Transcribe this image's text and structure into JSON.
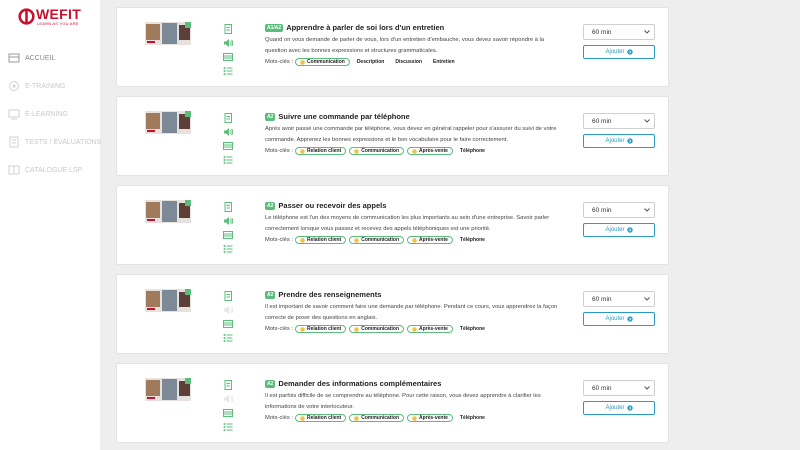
{
  "brand": {
    "name": "WEFIT",
    "tagline": "LEARN AS YOU ARE",
    "color": "#c8102e"
  },
  "sidebar": {
    "items": [
      {
        "label": "ACCUEIL",
        "icon": "home-icon",
        "active": true
      },
      {
        "label": "E-TRAINING",
        "icon": "training-icon",
        "active": false
      },
      {
        "label": "E-LEARNING",
        "icon": "elearning-icon",
        "active": false
      },
      {
        "label": "TESTS / ÉVALUATIONS",
        "icon": "tests-icon",
        "active": false
      },
      {
        "label": "CATALOGUE LSP",
        "icon": "catalogue-icon",
        "active": false
      }
    ]
  },
  "keywords_label": "Mots-clés :",
  "add_label": "Ajouter",
  "accent_color": "#5bbd7b",
  "button_color": "#2a9bc4",
  "courses": [
    {
      "level": "A1/A2",
      "title": "Apprendre à parler de soi lors d'un entretien",
      "description": "Quand on vous demande de parler de vous, lors d'un entretien d'embauche, vous devez savoir répondre à la question avec les bonnes expressions et structures grammaticales.",
      "duration": "60 min",
      "tags": [
        {
          "label": "Communication",
          "highlight": true
        },
        {
          "label": "Description",
          "highlight": false
        },
        {
          "label": "Discussion",
          "highlight": false
        },
        {
          "label": "Entretien",
          "highlight": false
        }
      ]
    },
    {
      "level": "A2",
      "title": "Suivre une commande par téléphone",
      "description": "Après avoir passé une commande par téléphone, vous devez en général rappeler pour s'assurer du suivi de votre commande. Apprenez les bonnes expressions et le bon vocabulaire pour le faire correctement.",
      "duration": "60 min",
      "tags": [
        {
          "label": "Relation client",
          "highlight": true
        },
        {
          "label": "Communication",
          "highlight": true
        },
        {
          "label": "Après-vente",
          "highlight": true
        },
        {
          "label": "Téléphone",
          "highlight": false
        }
      ]
    },
    {
      "level": "A2",
      "title": "Passer ou recevoir des appels",
      "description": "Le téléphone est l'un des moyens de communication les plus importants au sein d'une entreprise. Savoir parler correctement lorsque vous passez et recevez des appels téléphoniques est une priorité.",
      "duration": "60 min",
      "tags": [
        {
          "label": "Relation client",
          "highlight": true
        },
        {
          "label": "Communication",
          "highlight": true
        },
        {
          "label": "Après-vente",
          "highlight": true
        },
        {
          "label": "Téléphone",
          "highlight": false
        }
      ]
    },
    {
      "level": "A2",
      "title": "Prendre des renseignements",
      "description": "Il est important de savoir comment faire une demande par téléphone. Pendant ce cours, vous apprendrez la façon correcte de poser des questions en anglais.",
      "duration": "60 min",
      "tags": [
        {
          "label": "Relation client",
          "highlight": true
        },
        {
          "label": "Communication",
          "highlight": true
        },
        {
          "label": "Après-vente",
          "highlight": true
        },
        {
          "label": "Téléphone",
          "highlight": false
        }
      ]
    },
    {
      "level": "A2",
      "title": "Demander des informations complémentaires",
      "description": "Il est parfois difficile de se comprendre au téléphone. Pour cette raison, vous devez apprendre à clarifier les informations de votre interlocuteur.",
      "duration": "60 min",
      "tags": [
        {
          "label": "Relation client",
          "highlight": true
        },
        {
          "label": "Communication",
          "highlight": true
        },
        {
          "label": "Après-vente",
          "highlight": true
        },
        {
          "label": "Téléphone",
          "highlight": false
        }
      ]
    }
  ]
}
